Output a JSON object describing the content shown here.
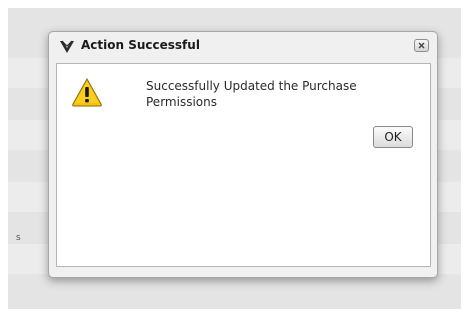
{
  "dialog": {
    "title": "Action Successful",
    "app_icon": "winged-logo-icon",
    "close_icon": "close-icon",
    "message_icon": "warning-icon",
    "message": "Successfully Updated the Purchase Permissions",
    "ok_label": "OK"
  },
  "background": {
    "edge_glyph": "s"
  },
  "colors": {
    "warning_fill": "#f5c211",
    "backdrop": "#e4e4e4",
    "dialog_frame": "#f0f0f0"
  }
}
